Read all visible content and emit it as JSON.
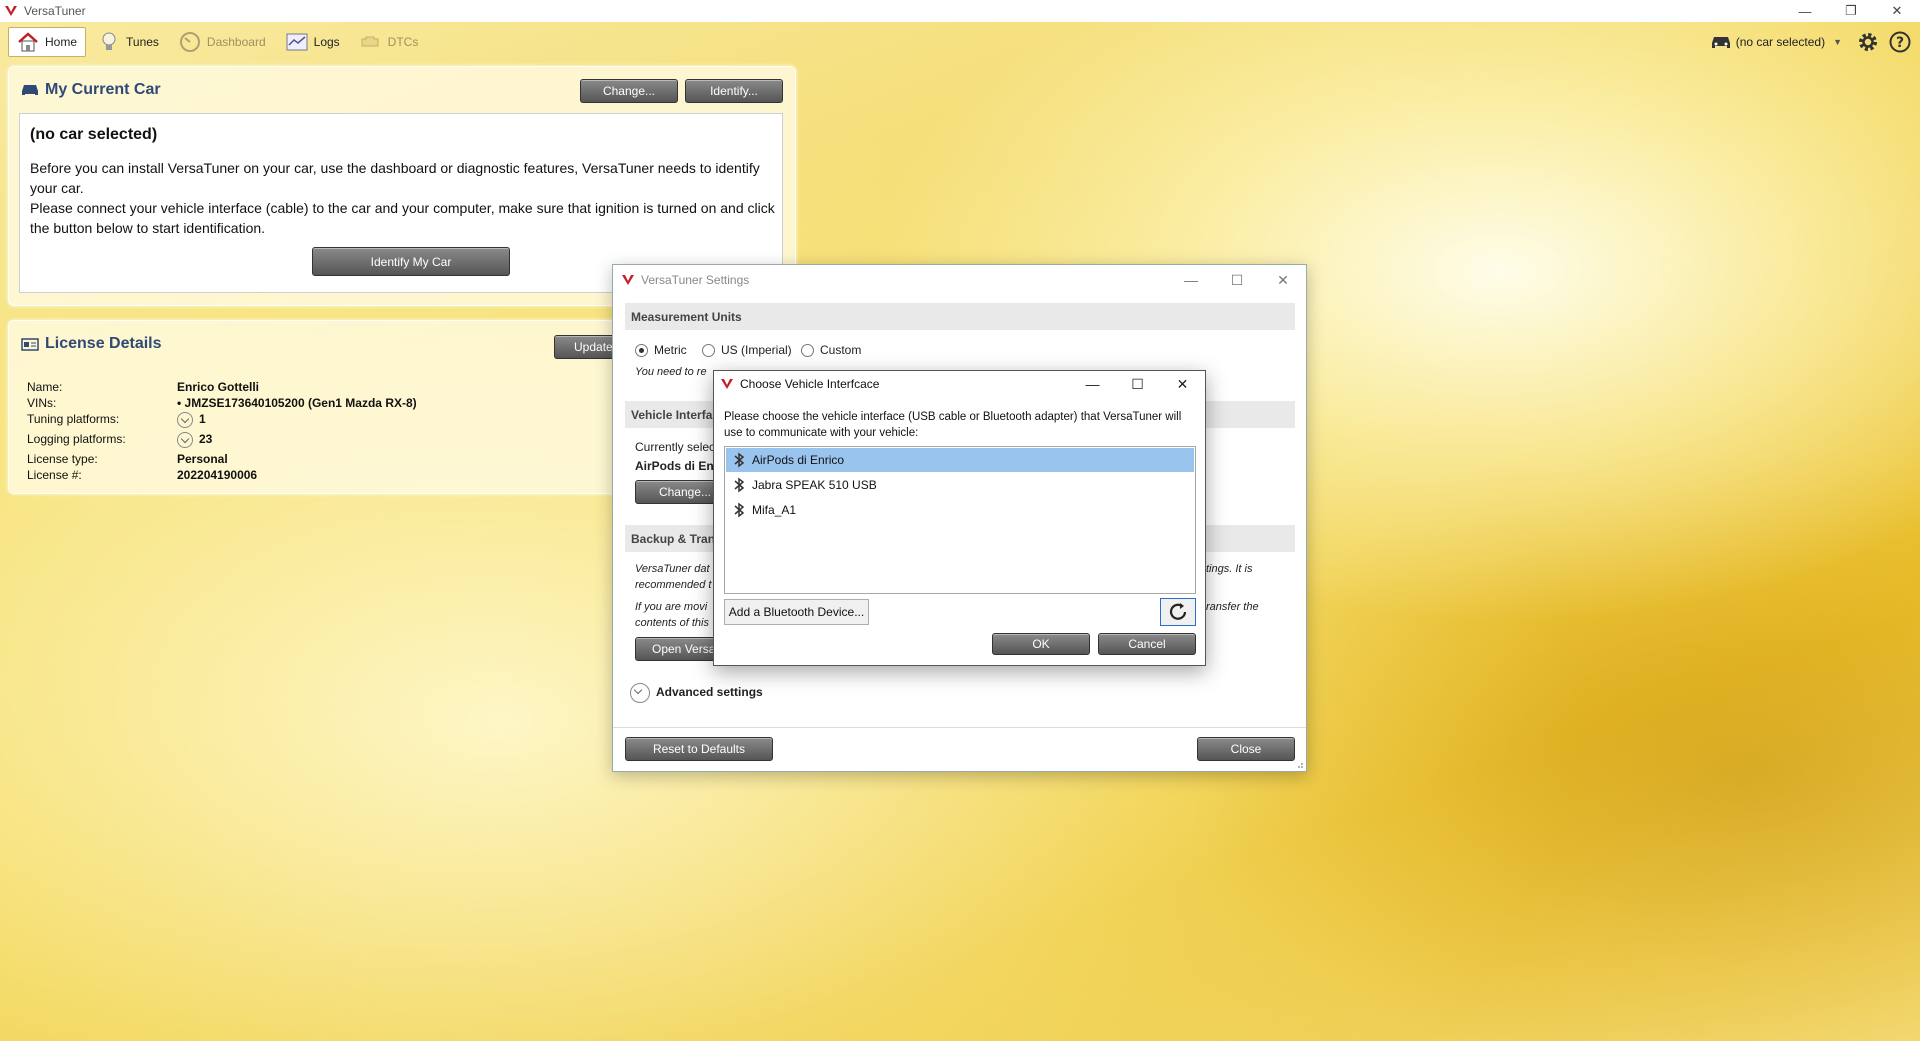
{
  "window": {
    "title": "VersaTuner"
  },
  "tabs": [
    {
      "label": "Home",
      "icon": "home-icon",
      "active": true
    },
    {
      "label": "Tunes",
      "icon": "bulb-icon"
    },
    {
      "label": "Dashboard",
      "icon": "gauge-icon",
      "disabled": true
    },
    {
      "label": "Logs",
      "icon": "logs-icon"
    },
    {
      "label": "DTCs",
      "icon": "engine-icon",
      "disabled": true
    }
  ],
  "header": {
    "car_selector": "(no car selected)"
  },
  "my_car": {
    "title": "My Current Car",
    "change_label": "Change...",
    "identify_label": "Identify...",
    "status": "(no car selected)",
    "paragraph1": "Before you can install VersaTuner on your car, use the dashboard or diagnostic features, VersaTuner needs to identify your car.",
    "paragraph2": "Please connect your vehicle interface (cable) to the car and your computer, make sure that ignition is turned on and click the button below to start identification.",
    "identify_my_car_label": "Identify My Car"
  },
  "license": {
    "title": "License Details",
    "update_label": "Update",
    "name_label": "Name:",
    "name": "Enrico Gottelli",
    "vins_label": "VINs:",
    "vin": "• JMZSE173640105200 (Gen1 Mazda RX-8)",
    "tuning_label": "Tuning platforms:",
    "tuning": "1",
    "logging_label": "Logging platforms:",
    "logging": "23",
    "type_label": "License type:",
    "type": "Personal",
    "number_label": "License #:",
    "number": "202204190006"
  },
  "settings": {
    "title": "VersaTuner Settings",
    "units_header": "Measurement Units",
    "unit_metric": "Metric",
    "unit_us": "US (Imperial)",
    "unit_custom": "Custom",
    "units_note": "You need to re",
    "interface_header": "Vehicle Interfa",
    "currently_selected": "Currently selec",
    "current_device": "AirPods di Enr",
    "change_label": "Change...",
    "backup_header": "Backup & Trans",
    "backup_text1a": "VersaTuner dat",
    "backup_text1b": "tings. It is",
    "backup_text1c": "recommended t",
    "backup_text2a": "If you are movi",
    "backup_text2b": "ransfer the",
    "backup_text2c": "contents of this",
    "open_label": "Open Versa",
    "advanced_label": "Advanced settings",
    "reset_label": "Reset to Defaults",
    "close_label": "Close"
  },
  "chooser": {
    "title": "Choose Vehicle Interfcace",
    "prompt": "Please choose the vehicle interface (USB cable or Bluetooth adapter) that VersaTuner will use to communicate with your vehicle:",
    "devices": [
      "AirPods di Enrico",
      "Jabra SPEAK 510 USB",
      "Mifa_A1"
    ],
    "add_bt_label": "Add a Bluetooth Device...",
    "ok_label": "OK",
    "cancel_label": "Cancel"
  }
}
